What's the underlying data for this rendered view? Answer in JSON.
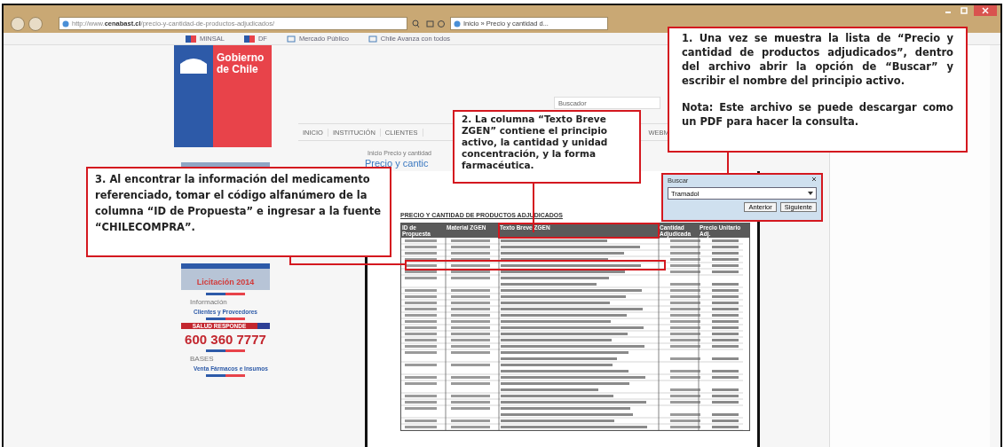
{
  "browser": {
    "address": "http://www.**cenabast.cl**/precio-y-cantidad-de-productos-adjudicados/",
    "tab": "Inicio » Precio y cantidad d..."
  },
  "favorites": [
    {
      "label": "MINSAL",
      "kind": "flag"
    },
    {
      "label": "DF",
      "kind": "flag"
    },
    {
      "label": "Mercado Público",
      "kind": "page"
    },
    {
      "label": "Chile Avanza con todos",
      "kind": "page"
    }
  ],
  "logo": {
    "text": "Gobierno de Chile"
  },
  "search": {
    "placeholder": "Buscador"
  },
  "nav": [
    "INICIO",
    "INSTITUCIÓN",
    "CLIENTES",
    "WEBM"
  ],
  "breadcrumb": "Inicio Precio y cantidad",
  "page_title": "Precio y cantic",
  "sidebar": [
    {
      "kind": "banner",
      "title": "Licitación 2014"
    },
    {
      "kind": "info",
      "line1": "Información",
      "line2": "Clientes y Proveedores"
    },
    {
      "kind": "phone",
      "label": "SALUD RESPONDE",
      "number": "600 360 7777"
    },
    {
      "kind": "info",
      "line1": "BASES",
      "line2": "Venta Fármacos e Insumos"
    }
  ],
  "document": {
    "title": "PRECIO Y CANTIDAD DE PRODUCTOS ADJUDICADOS",
    "columns": [
      {
        "label": "ID de Propuesta",
        "highlighted": false
      },
      {
        "label": "Material ZGEN",
        "highlighted": false
      },
      {
        "label": "Texto Breve ZGEN",
        "highlighted": true
      },
      {
        "label": "Cantidad Adjudicada",
        "highlighted": false
      },
      {
        "label": "Precio Unitario Adj.",
        "highlighted": false
      }
    ]
  },
  "find": {
    "title": "Buscar",
    "value": "Tramadol",
    "buttons": [
      "Anterior",
      "Siguiente"
    ]
  },
  "callouts": [
    {
      "paragraphs": [
        "**1.** Una vez se muestra la lista de “Precio y cantidad de productos adjudicados”, dentro del archivo abrir la opción de “Buscar” y escribir el nombre del principio activo.",
        "Nota: Este archivo se puede descargar como un PDF para hacer la consulta."
      ]
    },
    {
      "paragraphs": [
        "**2.** La columna “Texto Breve ZGEN” contiene el principio activo, la cantidad y unidad concentración, y la forma farmacéutica."
      ]
    },
    {
      "paragraphs": [
        "**3.** Al encontrar la información del medicamento referenciado, tomar el código alfanúmero de la columna “ID de Propuesta” e ingresar a la fuente “**CHILECOMPRA**”."
      ]
    }
  ]
}
